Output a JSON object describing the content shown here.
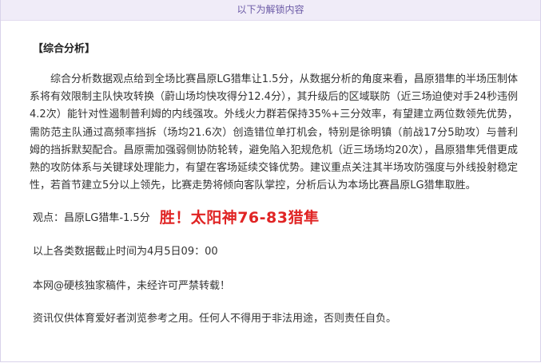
{
  "banner": {
    "text": "以下为解锁内容"
  },
  "article": {
    "section_heading": "【综合分析】",
    "analysis_paragraph": "综合分析数据观点给到全场比赛昌原LG猎隼让1.5分，从数据分析的角度来看，昌原猎隼的半场压制体系将有效限制主队快攻转换（蔚山场均快攻得分12.4分），其升级后的区域联防（近三场迫使对手24秒违例4.2次）能针对性遏制普利姆的内线强攻。外线火力群若保持35%+三分效率，有望建立两位数领先优势，需防范主队通过高频率挡拆（场均21.6次）创造错位单打机会，特别是徐明镇（前战17分5助攻）与普利姆的挡拆默契配合。昌原需加强弱侧协防轮转，避免陷入犯规危机（近三场场均20次），昌原猎隼凭借更成熟的攻防体系与关键球处理能力，有望在客场延续交锋优势。建议重点关注其半场攻防强度与外线投射稳定性，若首节建立5分以上领先，比赛走势将倾向客队掌控，分析后认为本场比赛昌原LG猎隼取胜。",
    "view_label": "观点：",
    "view_value": "昌原LG猎隼-1.5分",
    "result_badge": "胜！太阳神76-83猎隼",
    "cutoff_note": "以上各类数据截止时间为4月5日09：00",
    "copyright_note": "本网@硬核独家稿件，未经许可严禁转载！",
    "disclaimer_note": "资讯仅供体育爱好者浏览参考之用。任何人不得用于非法用途，否则责任自负。"
  },
  "colors": {
    "accent_red": "#e02424",
    "banner_bg": "#f0ecf8",
    "banner_text": "#6b5aa6"
  }
}
